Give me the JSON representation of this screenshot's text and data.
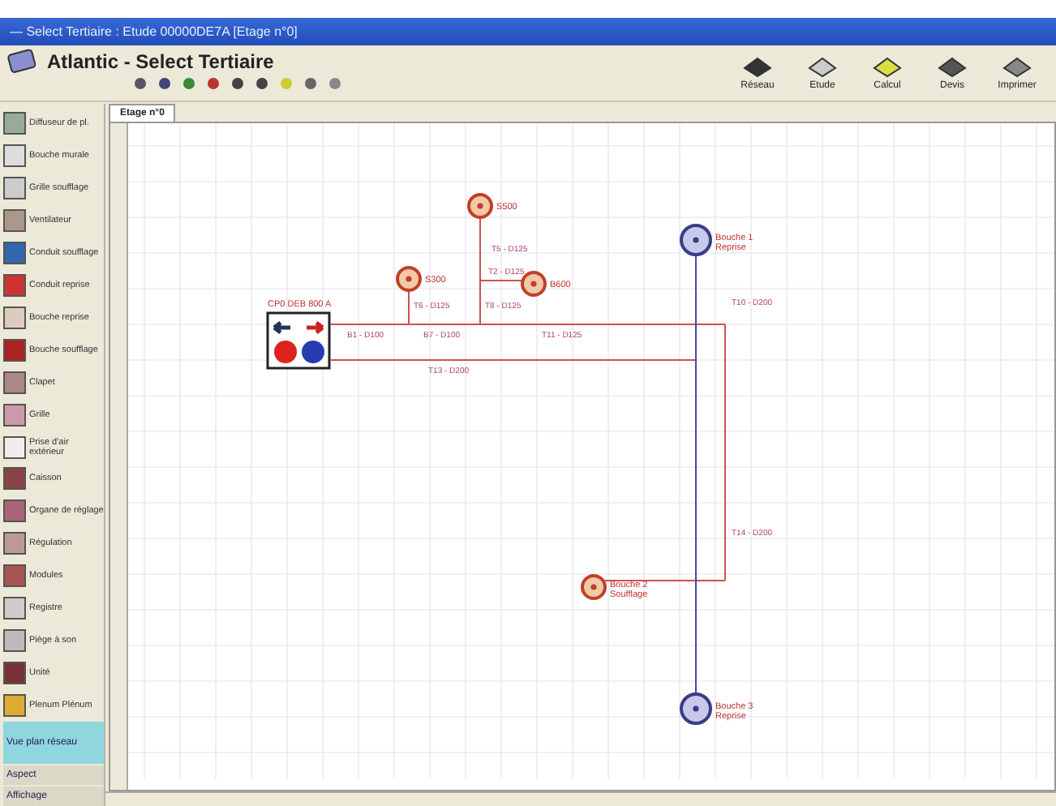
{
  "window": {
    "title": "— Select Tertiaire : Etude 00000DE7A [Etage n°0]"
  },
  "header": {
    "app_name": "Atlantic - Select Tertiaire"
  },
  "toolbar_right": [
    {
      "label": "Réseau"
    },
    {
      "label": "Etude"
    },
    {
      "label": "Calcul"
    },
    {
      "label": "Devis"
    },
    {
      "label": "Imprimer"
    }
  ],
  "palette": [
    {
      "label": "Diffuseur de pl."
    },
    {
      "label": "Bouche murale"
    },
    {
      "label": "Grille soufflage"
    },
    {
      "label": "Ventilateur"
    },
    {
      "label": "Conduit soufflage"
    },
    {
      "label": "Conduit reprise"
    },
    {
      "label": "Bouche reprise"
    },
    {
      "label": "Bouche soufflage"
    },
    {
      "label": "Clapet"
    },
    {
      "label": "Grille"
    },
    {
      "label": "Prise d'air extérieur"
    },
    {
      "label": "Caisson"
    },
    {
      "label": "Organe de réglage"
    },
    {
      "label": "Régulation"
    },
    {
      "label": "Modules"
    },
    {
      "label": "Registre"
    },
    {
      "label": "Piège à son"
    },
    {
      "label": "Unité"
    },
    {
      "label": "Plenum Plénum"
    }
  ],
  "palette_bottom": [
    {
      "label": "Vue plan réseau",
      "selected": true
    },
    {
      "label": "Aspect",
      "selected": false
    },
    {
      "label": "Affichage",
      "selected": false
    }
  ],
  "tabs": [
    {
      "label": "Etage n°0",
      "selected": true
    }
  ],
  "diagram": {
    "unit": {
      "label": "CP0 DEB 800 A"
    },
    "nodes": [
      {
        "kind": "supply",
        "label": "S500"
      },
      {
        "kind": "supply",
        "label": "S300"
      },
      {
        "kind": "supply",
        "label": "B600"
      },
      {
        "kind": "extract",
        "label": "Bouche 1 Reprise"
      },
      {
        "kind": "supply",
        "label": "Bouche 2 Soufflage"
      },
      {
        "kind": "extract",
        "label": "Bouche 3 Reprise"
      }
    ],
    "segments": [
      {
        "label": "T5 - D125"
      },
      {
        "label": "T2 - D125"
      },
      {
        "label": "T10 - D200"
      },
      {
        "label": "T6 - D125"
      },
      {
        "label": "T8 - D125"
      },
      {
        "label": "B1 - D100"
      },
      {
        "label": "B7 - D100"
      },
      {
        "label": "T11 - D125"
      },
      {
        "label": "T13 - D200"
      },
      {
        "label": "T14 - D200"
      }
    ]
  }
}
